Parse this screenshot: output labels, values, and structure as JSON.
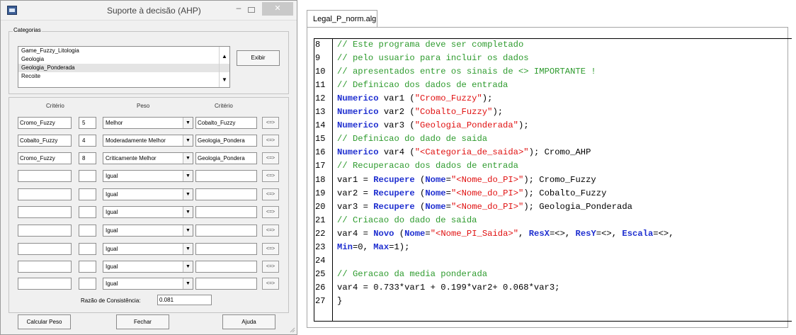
{
  "dialog": {
    "title": "Suporte à decisão (AHP)",
    "categories_label": "Categorias",
    "categories": [
      "Game_Fuzzy_Litologia",
      "Geologia",
      "Geologia_Ponderada",
      "Recoite"
    ],
    "selected_category": "Geologia_Ponderada",
    "exibir_label": "Exibir",
    "header_criterio_1": "Critério",
    "header_peso": "Peso",
    "header_criterio_2": "Critério",
    "rows": [
      {
        "c1": "Cromo_Fuzzy",
        "num": "5",
        "peso": "Melhor",
        "c2": "Cobalto_Fuzzy",
        "swap": "<=>"
      },
      {
        "c1": "Cobalto_Fuzzy",
        "num": "4",
        "peso": "Moderadamente Melhor",
        "c2": "Geologia_Pondera",
        "swap": "<=>"
      },
      {
        "c1": "Cromo_Fuzzy",
        "num": "8",
        "peso": "Criticamente Melhor",
        "c2": "Geologia_Pondera",
        "swap": "<=>"
      },
      {
        "c1": "",
        "num": "",
        "peso": "Igual",
        "c2": "",
        "swap": "<=>"
      },
      {
        "c1": "",
        "num": "",
        "peso": "Igual",
        "c2": "",
        "swap": "<=>"
      },
      {
        "c1": "",
        "num": "",
        "peso": "Igual",
        "c2": "",
        "swap": "<=>"
      },
      {
        "c1": "",
        "num": "",
        "peso": "Igual",
        "c2": "",
        "swap": "<=>"
      },
      {
        "c1": "",
        "num": "",
        "peso": "Igual",
        "c2": "",
        "swap": "<=>"
      },
      {
        "c1": "",
        "num": "",
        "peso": "Igual",
        "c2": "",
        "swap": "<=>"
      },
      {
        "c1": "",
        "num": "",
        "peso": "Igual",
        "c2": "",
        "swap": "<=>"
      }
    ],
    "consistency_label": "Razão de Consistência:",
    "consistency_value": "0.081",
    "buttons": {
      "calcular": "Calcular Peso",
      "fechar": "Fechar",
      "ajuda": "Ajuda"
    }
  },
  "editor": {
    "tab": "Legal_P_norm.alg",
    "lines": [
      {
        "n": "8",
        "code": "// Este programa deve ser completado"
      },
      {
        "n": "9",
        "code": "// pelo usuario para incluir os dados"
      },
      {
        "n": "10",
        "code": "// apresentados entre os sinais de <> IMPORTANTE !"
      },
      {
        "n": "11",
        "code": "// Definicao dos dados de entrada"
      },
      {
        "n": "12",
        "code": "Numerico var1 (\"Cromo_Fuzzy\");"
      },
      {
        "n": "13",
        "code": "Numerico var2 (\"Cobalto_Fuzzy\");"
      },
      {
        "n": "14",
        "code": "Numerico var3 (\"Geologia_Ponderada\");"
      },
      {
        "n": "15",
        "code": "// Definicao do dado de saida"
      },
      {
        "n": "16",
        "code": "Numerico var4 (\"<Categoria_de_saida>\"); Cromo_AHP"
      },
      {
        "n": "17",
        "code": "// Recuperacao dos dados de entrada"
      },
      {
        "n": "18",
        "code": "var1 = Recupere (Nome=\"<Nome_do_PI>\"); Cromo_Fuzzy"
      },
      {
        "n": "19",
        "code": "var2 = Recupere (Nome=\"<Nome_do_PI>\"); Cobalto_Fuzzy"
      },
      {
        "n": "20",
        "code": "var3 = Recupere (Nome=\"<Nome_do_PI>\"); Geologia_Ponderada"
      },
      {
        "n": "21",
        "code": "// Criacao do dado de saida"
      },
      {
        "n": "22",
        "code": "var4 = Novo (Nome=\"<Nome_PI_Saida>\", ResX=<>, ResY=<>, Escala=<>,"
      },
      {
        "n": "23",
        "code": "Min=0, Max=1);"
      },
      {
        "n": "24",
        "code": ""
      },
      {
        "n": "25",
        "code": "// Geracao da media ponderada"
      },
      {
        "n": "26",
        "code": "var4 = 0.733*var1 + 0.199*var2+ 0.068*var3;"
      },
      {
        "n": "27",
        "code": "}"
      }
    ],
    "colors": {
      "comment": "#2e9b2e",
      "keyword": "#1f2fd0",
      "string": "#e01010"
    }
  }
}
